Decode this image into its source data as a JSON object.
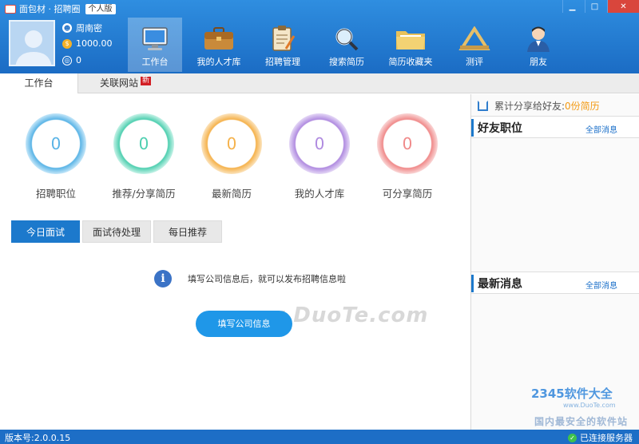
{
  "app": {
    "title": "面包材 · 招聘圈",
    "edition": "个人版"
  },
  "user": {
    "name": "周南密",
    "coins": "1000.00",
    "points": "0"
  },
  "nav": [
    {
      "label": "工作台",
      "icon": "monitor-icon",
      "active": true
    },
    {
      "label": "我的人才库",
      "icon": "briefcase-icon"
    },
    {
      "label": "招聘管理",
      "icon": "clipboard-icon"
    },
    {
      "label": "搜索简历",
      "icon": "magnifier-icon"
    },
    {
      "label": "简历收藏夹",
      "icon": "folder-icon"
    },
    {
      "label": "测评",
      "icon": "ruler-icon"
    },
    {
      "label": "朋友",
      "icon": "person-icon"
    }
  ],
  "tabs": {
    "workbench": "工作台",
    "related_sites": "关联网站",
    "new_badge": "新"
  },
  "stats": [
    {
      "value": "0",
      "label": "招聘职位",
      "color": "#5ab4e6"
    },
    {
      "value": "0",
      "label": "推荐/分享简历",
      "color": "#4fcfb0"
    },
    {
      "value": "0",
      "label": "最新简历",
      "color": "#f5b24c"
    },
    {
      "value": "0",
      "label": "我的人才库",
      "color": "#b08be0"
    },
    {
      "value": "0",
      "label": "可分享简历",
      "color": "#f08a8a"
    }
  ],
  "subtabs": {
    "today": "今日面试",
    "pending": "面试待处理",
    "daily": "每日推荐"
  },
  "info": {
    "message": "填写公司信息后，就可以发布招聘信息啦",
    "button": "填写公司信息"
  },
  "right": {
    "share_prefix": "累计分享给好友:",
    "share_count": "0份简历",
    "friends_title": "好友职位",
    "friends_link": "全部消息",
    "news_title": "最新消息",
    "news_link": "全部消息"
  },
  "status": {
    "version": "版本号:2.0.0.15",
    "connection": "已连接服务器"
  },
  "watermarks": {
    "duote": "www.DuoTe.com",
    "brand_2345": "2345软件大全",
    "brand_url": "www.DuoTe.com",
    "slogan": "国内最安全的软件站"
  },
  "colors": {
    "header": "#1f7ad4",
    "accent": "#1c79cc",
    "button": "#1f97e8",
    "share_count": "#f39a14"
  }
}
